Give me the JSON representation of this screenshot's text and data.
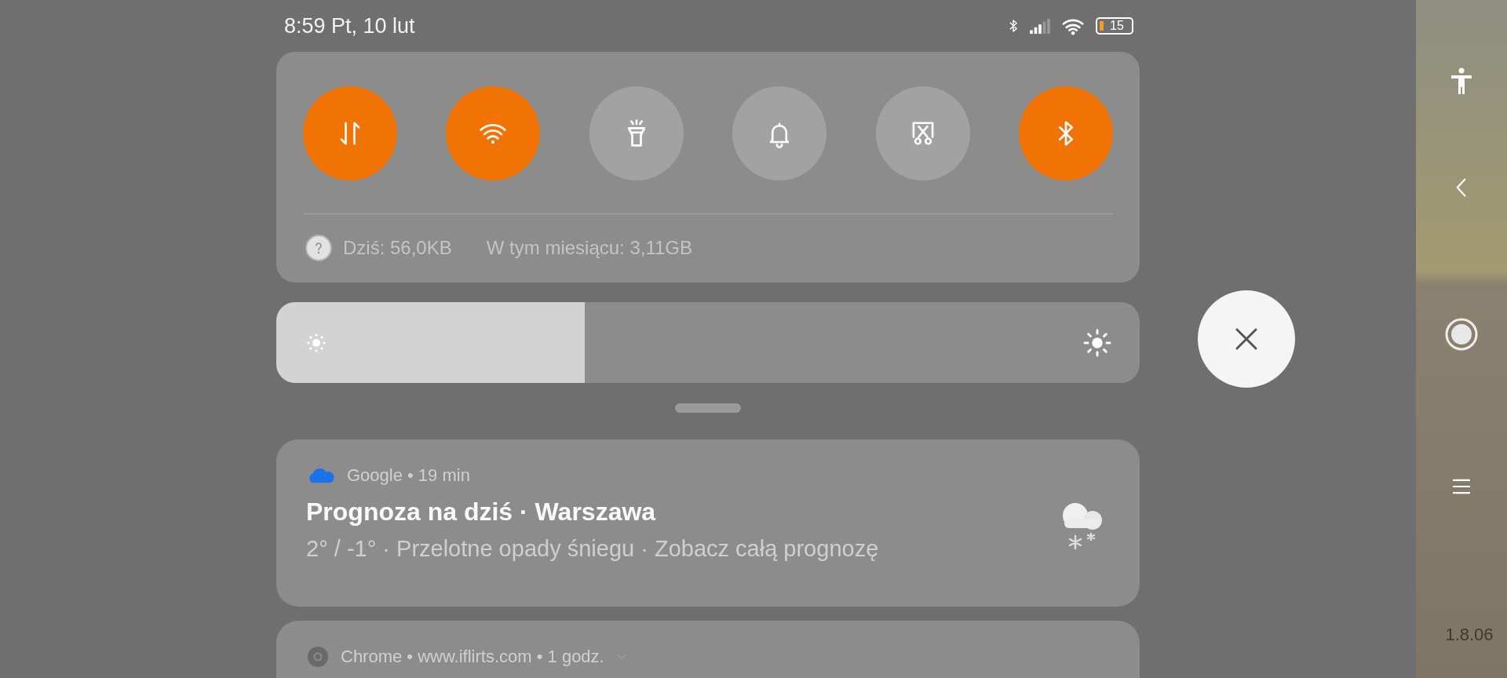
{
  "status_bar": {
    "time": "8:59 Pt, 10 lut",
    "battery": "15"
  },
  "quick_toggles": [
    {
      "kind": "mobile-data",
      "on": true
    },
    {
      "kind": "wifi",
      "on": true
    },
    {
      "kind": "flashlight",
      "on": false
    },
    {
      "kind": "bell",
      "on": false
    },
    {
      "kind": "screenshot",
      "on": false
    },
    {
      "kind": "bluetooth",
      "on": true
    }
  ],
  "data_usage": {
    "today": "Dziś: 56,0KB",
    "month": "W tym miesiącu: 3,11GB"
  },
  "brightness": {
    "level": 0.357
  },
  "notifications": [
    {
      "kind": "weather",
      "header": "Google • 19 min",
      "title": "Prognoza na dziś · Warszawa",
      "body": "2° / -1° · Przelotne opady śniegu · Zobacz całą prognozę"
    },
    {
      "kind": "browser",
      "header": "Chrome • www.iflirts.com • 1 godz."
    }
  ],
  "side_panel": {
    "version": "1.8.06"
  }
}
